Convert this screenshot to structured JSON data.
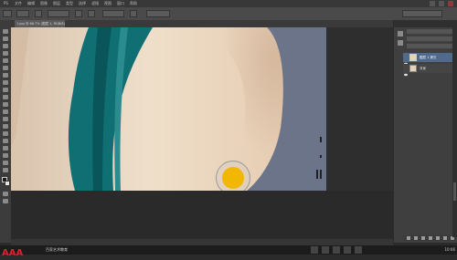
{
  "app": {
    "menu_items": [
      "PS",
      "文件",
      "编辑",
      "图像",
      "图层",
      "类型",
      "选择",
      "滤镜",
      "视图",
      "窗口",
      "帮助"
    ],
    "document_tab": "1.jpg @ 66.7% (图层 1, RGB/8)",
    "layers": {
      "layer_top_label": "图层 1 拷贝",
      "layer_bottom_label": "背景"
    },
    "watermark_text": "AAA",
    "watermark_subtitle": "百家艺术教育",
    "taskbar_clock": "10:06"
  }
}
